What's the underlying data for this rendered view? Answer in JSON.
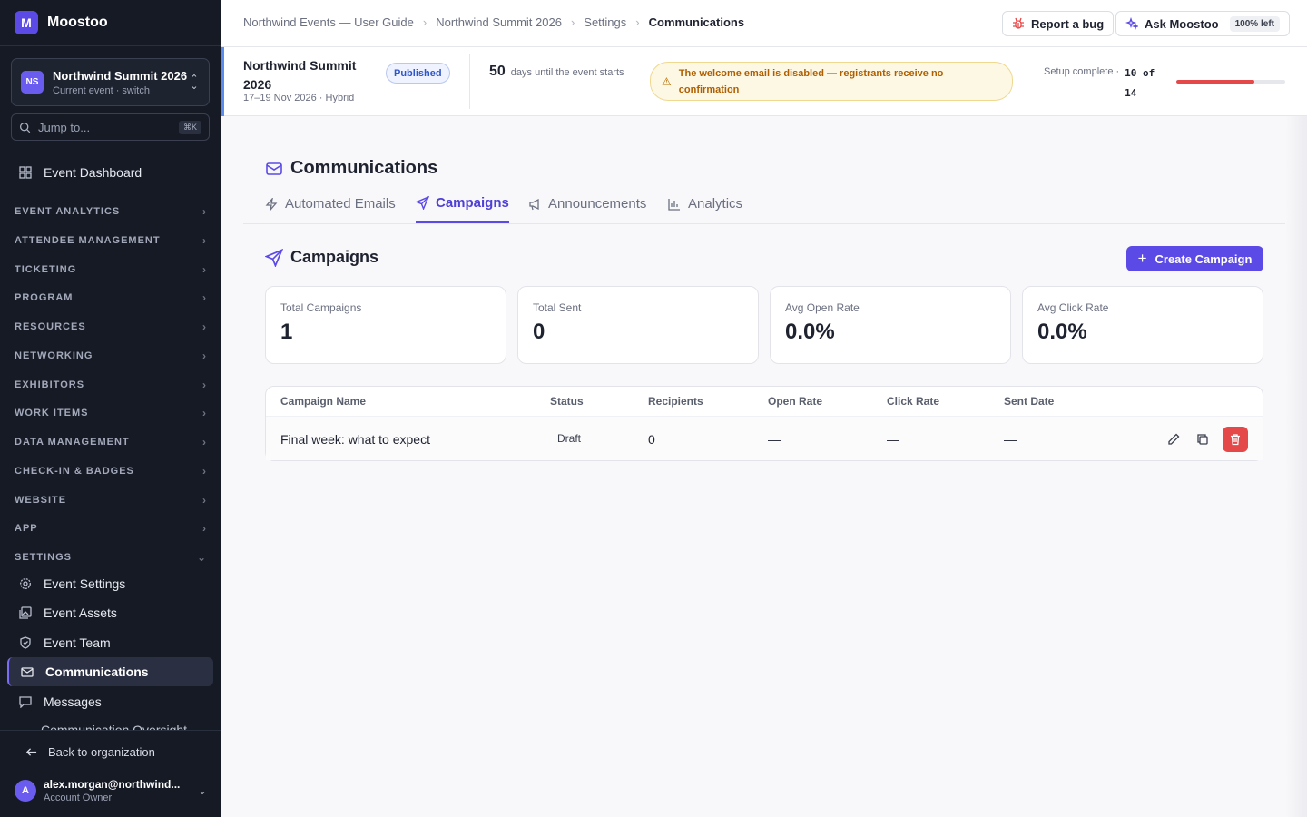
{
  "app": {
    "brand_letter": "M",
    "brand_name": "Moostoo"
  },
  "event_switcher": {
    "badge": "NS",
    "name": "Northwind Summit 2026",
    "sub": "Current event · switch"
  },
  "jump": {
    "placeholder": "Jump to...",
    "shortcut": "⌘K"
  },
  "sidebar": {
    "dashboard": "Event Dashboard",
    "sections": [
      "EVENT ANALYTICS",
      "ATTENDEE MANAGEMENT",
      "TICKETING",
      "PROGRAM",
      "RESOURCES",
      "NETWORKING",
      "EXHIBITORS",
      "WORK ITEMS",
      "DATA MANAGEMENT",
      "CHECK-IN & BADGES",
      "WEBSITE",
      "APP",
      "SETTINGS"
    ],
    "settings_items": [
      "Event Settings",
      "Event Assets",
      "Event Team",
      "Communications",
      "Messages",
      "Communication Oversight"
    ],
    "active_item": "Communications",
    "back": "Back to organization"
  },
  "user": {
    "initial": "A",
    "email": "alex.morgan@northwind...",
    "role": "Account Owner"
  },
  "breadcrumbs": [
    "Northwind Events — User Guide",
    "Northwind Summit 2026",
    "Settings",
    "Communications"
  ],
  "topbar": {
    "report_bug": "Report a bug",
    "ask": "Ask Moostoo",
    "ask_pill": "100% left"
  },
  "event_bar": {
    "title": "Northwind Summit 2026",
    "dates": "17–19 Nov 2026 · Hybrid",
    "status": "Published",
    "days_count": "50",
    "days_label": "days until the event starts",
    "warning": "The welcome email is disabled — registrants receive no confirmation",
    "setup_label": "Setup complete ·",
    "setup_count": "10 of 14",
    "setup_progress": 0.714,
    "progress_color": "#e54848"
  },
  "page": {
    "title": "Communications"
  },
  "tabs": [
    "Automated Emails",
    "Campaigns",
    "Announcements",
    "Analytics"
  ],
  "active_tab": "Campaigns",
  "campaigns": {
    "title": "Campaigns",
    "create_label": "Create Campaign",
    "stats": [
      {
        "label": "Total Campaigns",
        "value": "1"
      },
      {
        "label": "Total Sent",
        "value": "0"
      },
      {
        "label": "Avg Open Rate",
        "value": "0.0%"
      },
      {
        "label": "Avg Click Rate",
        "value": "0.0%"
      }
    ],
    "columns": [
      "Campaign Name",
      "Status",
      "Recipients",
      "Open Rate",
      "Click Rate",
      "Sent Date"
    ],
    "rows": [
      {
        "name": "Final week: what to expect",
        "status": "Draft",
        "recipients": "0",
        "open_rate": "—",
        "click_rate": "—",
        "sent_date": "—"
      }
    ]
  },
  "colors": {
    "accent": "#5b4ae6",
    "sidebar_bg": "#161a25",
    "danger": "#e54848",
    "warning_text": "#b05f00"
  }
}
